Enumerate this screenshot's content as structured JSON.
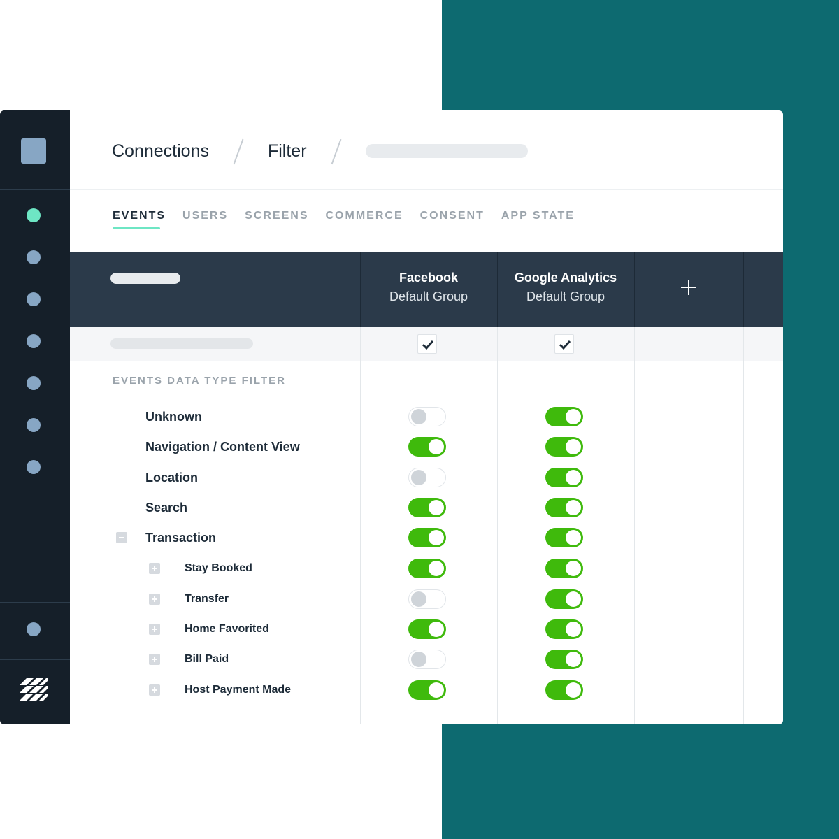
{
  "breadcrumb": {
    "items": [
      "Connections",
      "Filter"
    ]
  },
  "tabs": [
    "EVENTS",
    "USERS",
    "SCREENS",
    "COMMERCE",
    "CONSENT",
    "APP STATE"
  ],
  "active_tab": "EVENTS",
  "columns": [
    {
      "title": "Facebook",
      "subtitle": "Default Group",
      "select_all_checked": true
    },
    {
      "title": "Google Analytics",
      "subtitle": "Default Group",
      "select_all_checked": true
    }
  ],
  "section_title": "EVENTS DATA TYPE FILTER",
  "rows": [
    {
      "label": "Unknown",
      "level": 0,
      "toggles": [
        false,
        true
      ]
    },
    {
      "label": "Navigation / Content View",
      "level": 0,
      "toggles": [
        true,
        true
      ]
    },
    {
      "label": "Location",
      "level": 0,
      "toggles": [
        false,
        true
      ]
    },
    {
      "label": "Search",
      "level": 0,
      "toggles": [
        true,
        true
      ]
    },
    {
      "label": "Transaction",
      "level": 0,
      "expanded": true,
      "toggles": [
        true,
        true
      ]
    },
    {
      "label": "Stay Booked",
      "level": 1,
      "toggles": [
        true,
        true
      ]
    },
    {
      "label": "Transfer",
      "level": 1,
      "toggles": [
        false,
        true
      ]
    },
    {
      "label": "Home Favorited",
      "level": 1,
      "toggles": [
        true,
        true
      ]
    },
    {
      "label": "Bill Paid",
      "level": 1,
      "toggles": [
        false,
        true
      ]
    },
    {
      "label": "Host Payment Made",
      "level": 1,
      "toggles": [
        true,
        true
      ]
    }
  ],
  "colors": {
    "teal_bg": "#0d6a70",
    "sidebar": "#151f29",
    "table_header": "#2b3a4a",
    "toggle_on": "#3fba0c",
    "accent": "#6ee6c4"
  },
  "icons": {
    "add": "plus-icon",
    "checkbox": "checkmark-icon",
    "expand": "plus-square-icon",
    "collapse": "minus-square-icon",
    "brand": "brand-logo-icon"
  }
}
